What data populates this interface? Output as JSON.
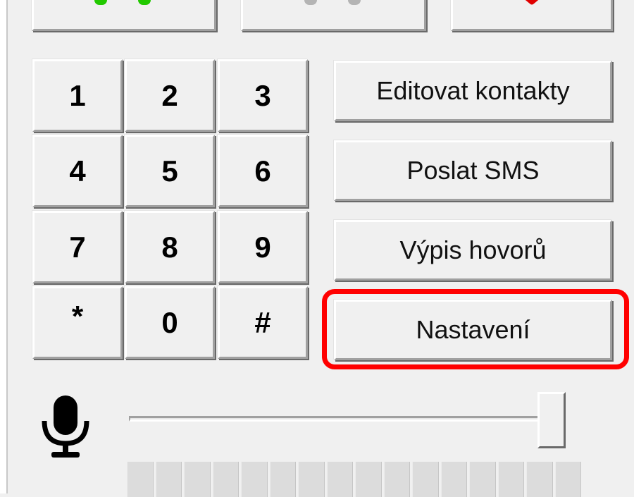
{
  "top_buttons": [
    {
      "name": "call-button",
      "icon": "handset-green-icon",
      "color": "#22c900"
    },
    {
      "name": "hold-button",
      "icon": "handset-gray-icon",
      "color": "#b4b4b4"
    },
    {
      "name": "hangup-button",
      "icon": "red-x-icon",
      "color": "#e00000"
    }
  ],
  "keypad": {
    "keys": [
      "1",
      "2",
      "3",
      "4",
      "5",
      "6",
      "7",
      "8",
      "9",
      "*",
      "0",
      "#"
    ]
  },
  "side_buttons": {
    "edit_contacts": "Editovat kontakty",
    "send_sms": "Poslat SMS",
    "call_log": "Výpis hovorů",
    "settings": "Nastavení"
  },
  "highlight_color": "#ff0000",
  "microphone": {
    "icon": "microphone-icon",
    "volume": 1.0
  },
  "level_meter": {
    "segments": 16,
    "active": 0
  }
}
